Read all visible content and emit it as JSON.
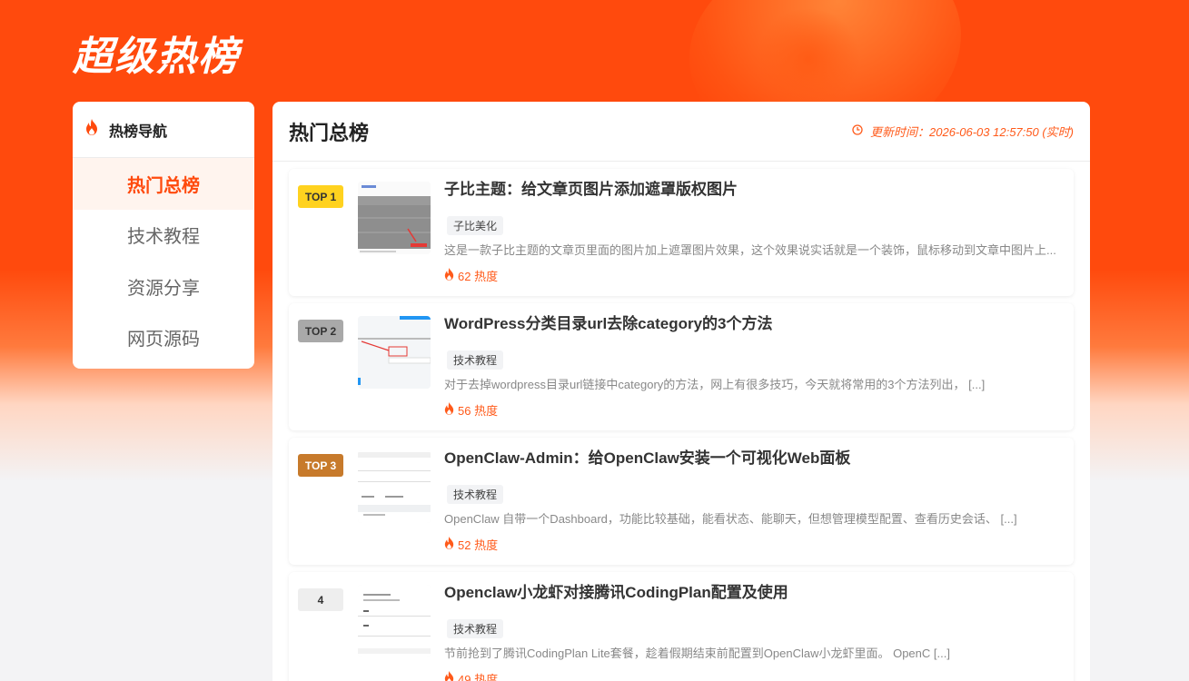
{
  "site": {
    "title": "超级热榜"
  },
  "sidebar": {
    "heading": "热榜导航",
    "heading_icon": "fire-icon",
    "items": [
      {
        "label": "热门总榜",
        "active": true
      },
      {
        "label": "技术教程",
        "active": false
      },
      {
        "label": "资源分享",
        "active": false
      },
      {
        "label": "网页源码",
        "active": false
      }
    ]
  },
  "main": {
    "title": "热门总榜",
    "update_icon": "clock-icon",
    "update_text": "更新时间：2026-06-03 12:57:50 (实时)",
    "articles": [
      {
        "rank": "TOP 1",
        "title": "子比主题：给文章页图片添加遮罩版权图片",
        "tag": "子比美化",
        "excerpt": "这是一款子比主题的文章页里面的图片加上遮罩图片效果，这个效果说实话就是一个装饰，鼠标移动到文章中图片上...",
        "heat": "62 热度"
      },
      {
        "rank": "TOP 2",
        "title": "WordPress分类目录url去除category的3个方法",
        "tag": "技术教程",
        "excerpt": "对于去掉wordpress目录url链接中category的方法，网上有很多技巧，今天就将常用的3个方法列出，  [...]",
        "heat": "56 热度"
      },
      {
        "rank": "TOP 3",
        "title": "OpenClaw-Admin：给OpenClaw安装一个可视化Web面板",
        "tag": "技术教程",
        "excerpt": "OpenClaw 自带一个Dashboard，功能比较基础，能看状态、能聊天，但想管理模型配置、查看历史会话、 [...]",
        "heat": "52 热度"
      },
      {
        "rank": "4",
        "title": "Openclaw小龙虾对接腾讯CodingPlan配置及使用",
        "tag": "技术教程",
        "excerpt": "节前抢到了腾讯CodingPlan Lite套餐，趁着假期结束前配置到OpenClaw小龙虾里面。 OpenC [...]",
        "heat": "49 热度"
      }
    ]
  },
  "colors": {
    "brand": "#ff4a0d",
    "rank1": "#ffd21f",
    "rank2": "#a9a9a9",
    "rank3": "#c77a2b",
    "heat": "#ff5a1a"
  }
}
